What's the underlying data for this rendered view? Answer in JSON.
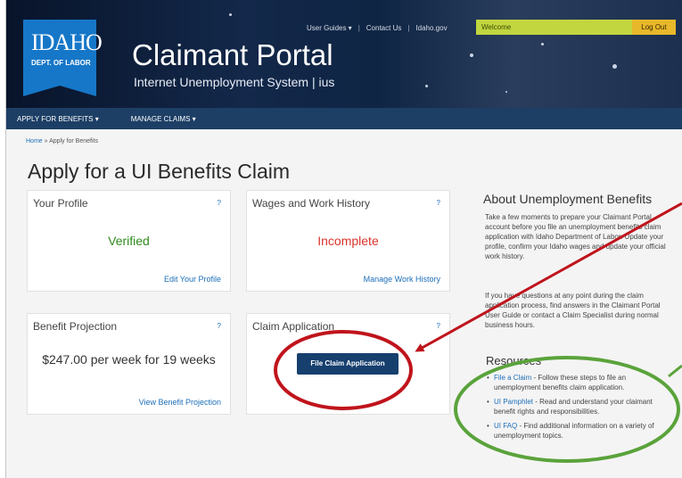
{
  "header": {
    "logo_main": "IDAHO",
    "logo_sub": "DEPT. OF LABOR",
    "title": "Claimant Portal",
    "subtitle": "Internet Unemployment System | ius",
    "links": [
      "User Guides ▾",
      "Contact Us",
      "Idaho.gov"
    ],
    "welcome": "Welcome",
    "logout": "Log Out"
  },
  "nav": {
    "items": [
      "APPLY FOR BENEFITS ▾",
      "MANAGE CLAIMS ▾"
    ]
  },
  "breadcrumb": {
    "home": "Home",
    "sep": "»",
    "current": "Apply for Benefits"
  },
  "page": {
    "title": "Apply for a UI Benefits Claim"
  },
  "cards": {
    "profile": {
      "title": "Your Profile",
      "help": "?",
      "status": "Verified",
      "link": "Edit Your Profile"
    },
    "wages": {
      "title": "Wages and Work History",
      "help": "?",
      "status": "Incomplete",
      "link": "Manage Work History"
    },
    "projection": {
      "title": "Benefit Projection",
      "help": "?",
      "value": "$247.00 per week for 19 weeks",
      "link": "View Benefit Projection"
    },
    "claim": {
      "title": "Claim Application",
      "help": "?",
      "button": "File Claim Application"
    }
  },
  "about": {
    "title": "About Unemployment Benefits",
    "p1": "Take a few moments to prepare your Claimant Portal account before you file an unemployment benefits claim application with Idaho Department of Labor. Update your profile, confirm your Idaho wages and update your official work history.",
    "p2": "If you have questions at any point during the claim application process, find answers in the Claimant Portal User Guide or contact a Claim Specialist during normal business hours."
  },
  "resources": {
    "title": "Resources",
    "items": [
      {
        "link": "File a Claim",
        "text": " - Follow these steps to file an unemployment benefits claim application."
      },
      {
        "link": "UI Pamphlet",
        "text": " - Read and understand your claimant benefit rights and responsibilities."
      },
      {
        "link": "UI FAQ",
        "text": " - Find additional information on a variety of unemployment topics."
      }
    ]
  },
  "colors": {
    "nav": "#1d3f66",
    "logo": "#1677c8",
    "welcome": "#c2d640",
    "logout": "#e7b82a",
    "annotation_red": "#c0141c",
    "annotation_green": "#5aa33b"
  }
}
